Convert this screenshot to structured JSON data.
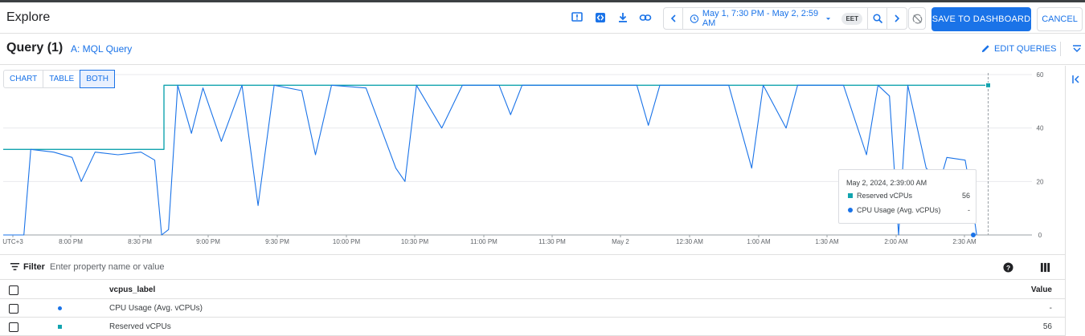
{
  "header": {
    "title": "Explore",
    "time_range": "May 1, 7:30 PM - May 2, 2:59 AM",
    "timezone": "EET",
    "save_label": "SAVE TO DASHBOARD",
    "cancel_label": "CANCEL"
  },
  "query": {
    "title": "Query (1)",
    "link": "A: MQL Query",
    "edit_label": "EDIT QUERIES"
  },
  "view_toggle": [
    "CHART",
    "TABLE",
    "BOTH"
  ],
  "colors": {
    "accent": "#1a73e8",
    "reserved_series": "#12a4af",
    "cpu_series": "#1a73e8"
  },
  "chart_data": {
    "type": "line",
    "y_ticks": [
      "60",
      "40",
      "20",
      "0"
    ],
    "ylim": [
      0,
      60
    ],
    "x_ticks": [
      "UTC+3",
      "8:00 PM",
      "8:30 PM",
      "9:00 PM",
      "9:30 PM",
      "10:00 PM",
      "10:30 PM",
      "11:00 PM",
      "11:30 PM",
      "May 2",
      "12:30 AM",
      "1:00 AM",
      "1:30 AM",
      "2:00 AM",
      "2:30 AM"
    ],
    "series": [
      {
        "name": "Reserved vCPUs",
        "color": "#12a4af",
        "points": [
          [
            "7:30 PM",
            32
          ],
          [
            "8:40 PM",
            32
          ],
          [
            "8:40 PM",
            56
          ],
          [
            "2:39 AM",
            56
          ]
        ]
      },
      {
        "name": "CPU Usage (Avg. vCPUs)",
        "color": "#1a73e8",
        "points": [
          [
            "7:30 PM",
            0
          ],
          [
            "7:39 PM",
            0
          ],
          [
            "7:42 PM",
            32
          ],
          [
            "7:52 PM",
            31
          ],
          [
            "8:00 PM",
            29
          ],
          [
            "8:04 PM",
            20
          ],
          [
            "8:10 PM",
            31
          ],
          [
            "8:20 PM",
            30
          ],
          [
            "8:30 PM",
            31
          ],
          [
            "8:36 PM",
            28
          ],
          [
            "8:39 PM",
            0
          ],
          [
            "8:42 PM",
            2
          ],
          [
            "8:46 PM",
            56
          ],
          [
            "8:52 PM",
            38
          ],
          [
            "8:57 PM",
            55
          ],
          [
            "9:05 PM",
            35
          ],
          [
            "9:14 PM",
            56
          ],
          [
            "9:21 PM",
            11
          ],
          [
            "9:28 PM",
            56
          ],
          [
            "9:40 PM",
            54
          ],
          [
            "9:46 PM",
            30
          ],
          [
            "9:53 PM",
            56
          ],
          [
            "10:08 PM",
            55
          ],
          [
            "10:21 PM",
            25
          ],
          [
            "10:25 PM",
            20
          ],
          [
            "10:30 PM",
            56
          ],
          [
            "10:41 PM",
            40
          ],
          [
            "10:50 PM",
            56
          ],
          [
            "11:06 PM",
            56
          ],
          [
            "11:11 PM",
            45
          ],
          [
            "11:16 PM",
            56
          ],
          [
            "11:46 PM",
            56
          ],
          [
            "12:06 AM",
            56
          ],
          [
            "12:11 AM",
            41
          ],
          [
            "12:16 AM",
            56
          ],
          [
            "12:46 AM",
            56
          ],
          [
            "12:56 AM",
            25
          ],
          [
            "1:01 AM",
            56
          ],
          [
            "1:11 AM",
            40
          ],
          [
            "1:16 AM",
            56
          ],
          [
            "1:36 AM",
            56
          ],
          [
            "1:46 AM",
            30
          ],
          [
            "1:51 AM",
            56
          ],
          [
            "1:56 AM",
            52
          ],
          [
            "2:00 AM",
            0
          ],
          [
            "2:04 AM",
            56
          ],
          [
            "2:12 AM",
            25
          ],
          [
            "2:18 AM",
            20
          ],
          [
            "2:21 AM",
            29
          ],
          [
            "2:29 AM",
            28
          ],
          [
            "2:31 AM",
            18
          ],
          [
            "2:34 AM",
            0
          ]
        ]
      }
    ],
    "tooltip": {
      "title": "May 2, 2024, 2:39:00 AM",
      "rows": [
        {
          "name": "Reserved vCPUs",
          "value": "56"
        },
        {
          "name": "CPU Usage (Avg. vCPUs)",
          "value": "-"
        }
      ]
    }
  },
  "filter": {
    "label": "Filter",
    "placeholder": "Enter property name or value"
  },
  "table": {
    "columns": [
      "vcpus_label",
      "Value"
    ],
    "rows": [
      {
        "label": "CPU Usage (Avg. vCPUs)",
        "value": "-"
      },
      {
        "label": "Reserved vCPUs",
        "value": "56"
      }
    ]
  }
}
